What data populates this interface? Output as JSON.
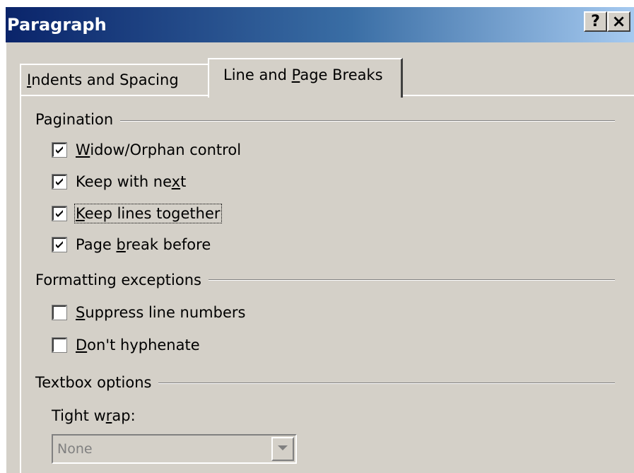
{
  "dialog": {
    "title": "Paragraph",
    "help_label": "?",
    "close_label": "×"
  },
  "tabs": [
    {
      "label_pre": "",
      "accel": "I",
      "label_post": "ndents and Spacing",
      "active": false
    },
    {
      "label_pre": "Line and ",
      "accel": "P",
      "label_post": "age Breaks",
      "active": true
    }
  ],
  "pagination": {
    "heading": "Pagination",
    "options": [
      {
        "pre": "",
        "accel": "W",
        "post": "idow/Orphan control",
        "checked": true
      },
      {
        "pre": "Keep with ne",
        "accel": "x",
        "post": "t",
        "checked": true
      },
      {
        "pre": "",
        "accel": "K",
        "post": "eep lines together",
        "checked": true,
        "focused": true
      },
      {
        "pre": "Page ",
        "accel": "b",
        "post": "reak before",
        "checked": true
      }
    ]
  },
  "formatting_exceptions": {
    "heading": "Formatting exceptions",
    "options": [
      {
        "pre": "",
        "accel": "S",
        "post": "uppress line numbers",
        "checked": false
      },
      {
        "pre": "",
        "accel": "D",
        "post": "on't hyphenate",
        "checked": false
      }
    ]
  },
  "textbox_options": {
    "heading": "Textbox options",
    "tight_wrap_pre": "Tight w",
    "tight_wrap_accel": "r",
    "tight_wrap_post": "ap:",
    "tight_wrap_value": "None",
    "tight_wrap_enabled": false
  },
  "icons": {
    "checkmark": "checkmark-icon",
    "dropdown": "chevron-down-icon"
  }
}
